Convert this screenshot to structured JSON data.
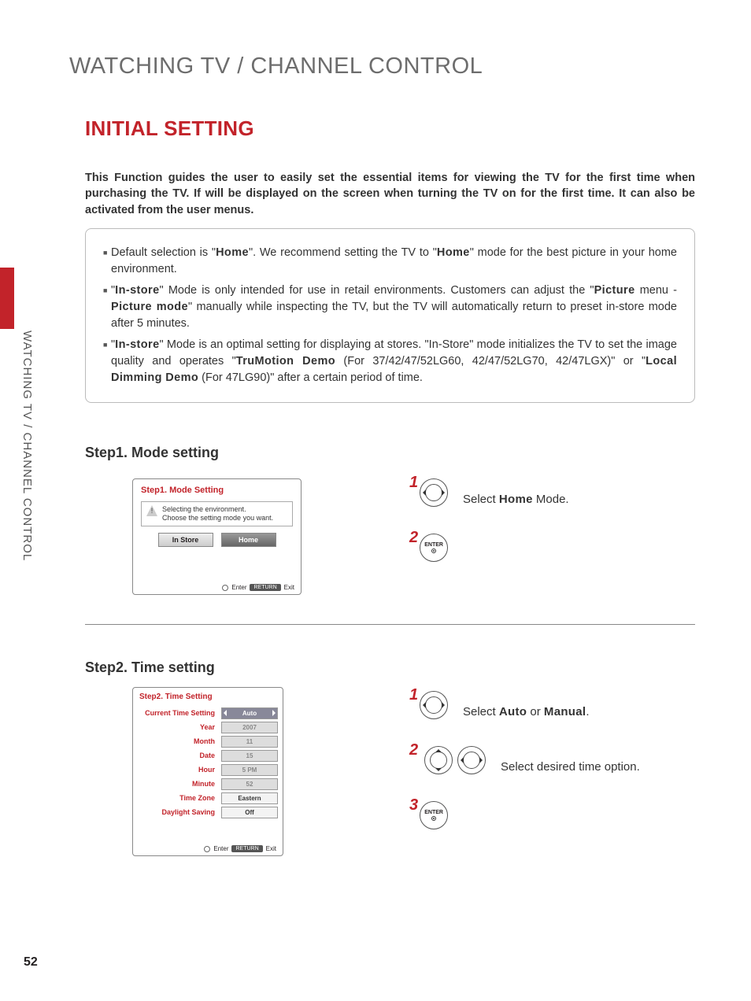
{
  "page": {
    "title": "WATCHING TV / CHANNEL CONTROL",
    "section": "INITIAL SETTING",
    "sidebar": "WATCHING TV / CHANNEL CONTROL",
    "number": "52"
  },
  "intro": "This Function guides the user to easily set the essential items for viewing the TV for the first time when purchasing the TV. If will be displayed on the screen when turning the TV on for the first time. It can also be activated from the user menus.",
  "notes": {
    "b1a": "Default selection is \"",
    "b1b": "Home",
    "b1c": "\". We recommend setting the TV to \"",
    "b1d": "Home",
    "b1e": "\" mode for the best picture in your home environment.",
    "b2a": "\"",
    "b2b": "In-store",
    "b2c": "\" Mode is only intended for use in retail environments. Customers can adjust the \"",
    "b2d": "Picture",
    "b2e": " menu - ",
    "b2f": "Picture mode",
    "b2g": "\" manually while inspecting the TV, but the TV will automatically return to preset in-store mode after 5 minutes.",
    "b3a": "\"",
    "b3b": "In-store",
    "b3c": "\" Mode is an optimal setting for displaying at stores. \"In-Store\" mode initializes the TV to set the image quality and operates \"",
    "b3d": "TruMotion Demo",
    "b3e": " (For 37/42/47/52LG60, 42/47/52LG70, 42/47LGX)\" or \"",
    "b3f": "Local Dimming Demo",
    "b3g": " (For 47LG90)\" after a certain period of time."
  },
  "step1": {
    "heading": "Step1. Mode setting",
    "panel_title": "Step1. Mode Setting",
    "msg1": "Selecting the environment.",
    "msg2": "Choose the setting mode you want.",
    "btn_instore": "In Store",
    "btn_home": "Home",
    "enter": "Enter",
    "return": "RETURN",
    "exit": "Exit",
    "instr1a": "Select ",
    "instr1b": "Home",
    "instr1c": " Mode.",
    "n1": "1",
    "n2": "2",
    "enter_label": "ENTER"
  },
  "step2": {
    "heading": "Step2. Time setting",
    "panel_title": "Step2. Time Setting",
    "rows": {
      "cts": "Current Time Setting",
      "cts_v": "Auto",
      "year": "Year",
      "year_v": "2007",
      "month": "Month",
      "month_v": "11",
      "date": "Date",
      "date_v": "15",
      "hour": "Hour",
      "hour_v": "5 PM",
      "minute": "Minute",
      "minute_v": "52",
      "tz": "Time Zone",
      "tz_v": "Eastern",
      "ds": "Daylight Saving",
      "ds_v": "Off"
    },
    "enter": "Enter",
    "return": "RETURN",
    "exit": "Exit",
    "instr1a": "Select ",
    "instr1b": "Auto",
    "instr1c": " or ",
    "instr1d": "Manual",
    "instr1e": ".",
    "instr2": "Select desired time option.",
    "n1": "1",
    "n2": "2",
    "n3": "3",
    "enter_label": "ENTER"
  }
}
